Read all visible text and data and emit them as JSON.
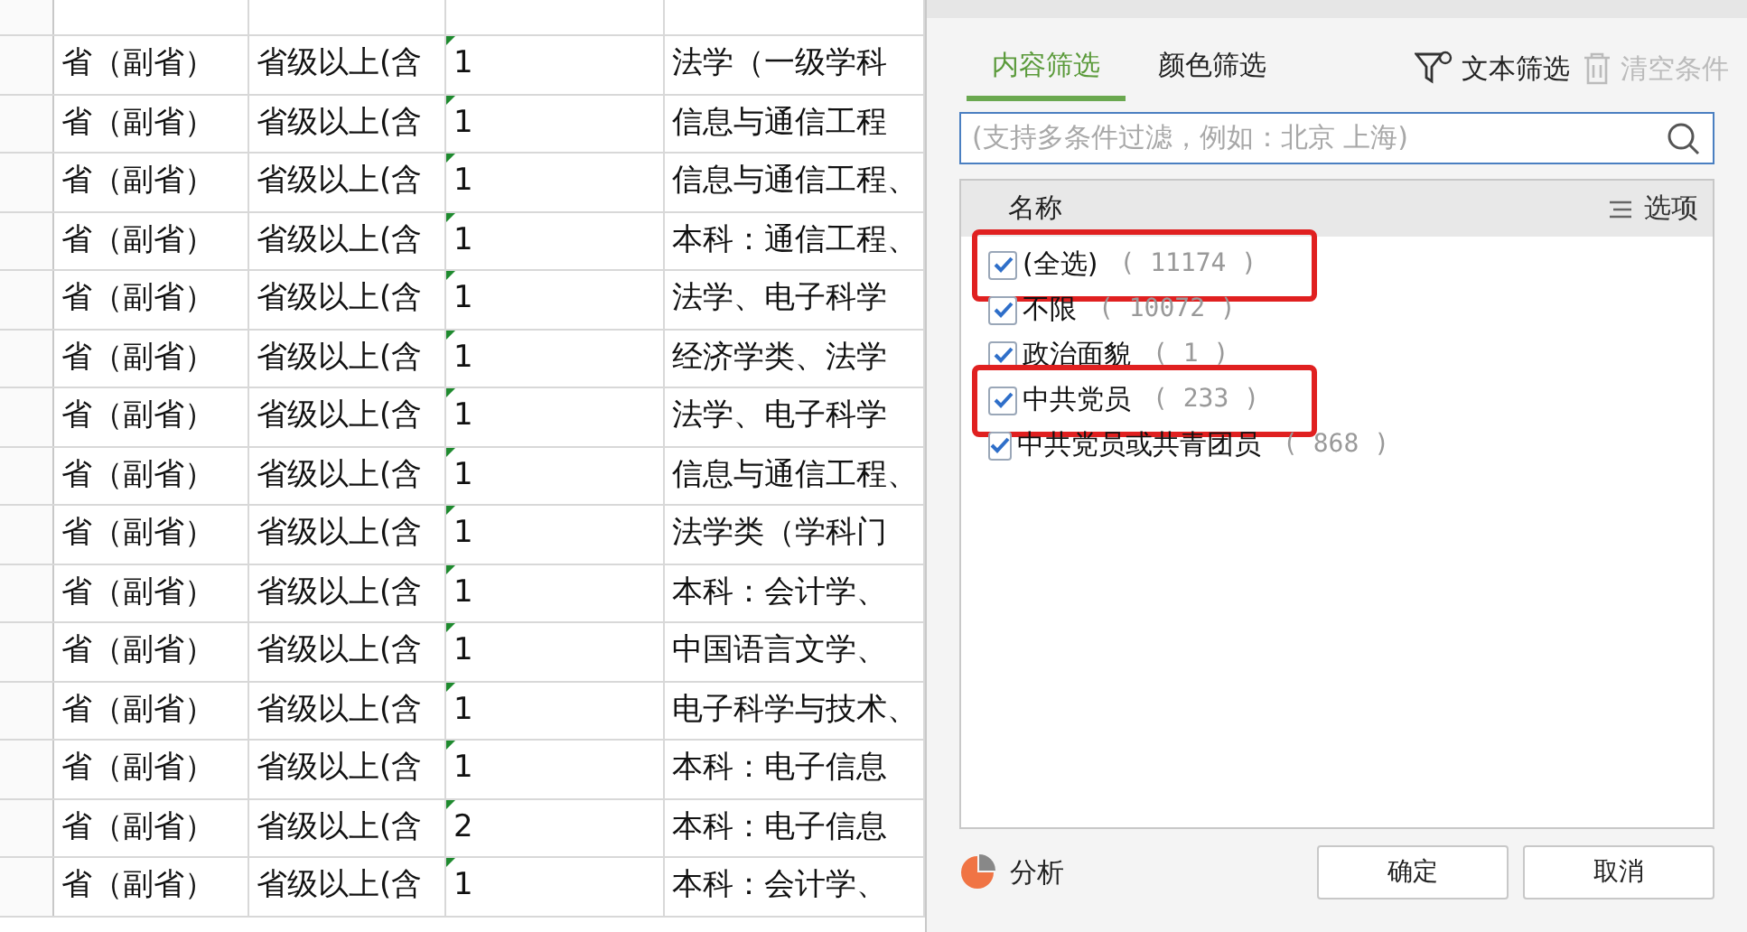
{
  "sheet": {
    "rows": [
      {
        "cells": [
          "省（副省）",
          "省级以上(含",
          "1",
          "法学（一级学科"
        ],
        "number_as_text": true
      },
      {
        "cells": [
          "省（副省）",
          "省级以上(含",
          "1",
          "信息与通信工程"
        ],
        "number_as_text": true
      },
      {
        "cells": [
          "省（副省）",
          "省级以上(含",
          "1",
          "信息与通信工程、"
        ],
        "number_as_text": true
      },
      {
        "cells": [
          "省（副省）",
          "省级以上(含",
          "1",
          "本科：通信工程、"
        ],
        "number_as_text": true
      },
      {
        "cells": [
          "省（副省）",
          "省级以上(含",
          "1",
          "法学、电子科学"
        ],
        "number_as_text": true
      },
      {
        "cells": [
          "省（副省）",
          "省级以上(含",
          "1",
          "经济学类、法学"
        ],
        "number_as_text": true
      },
      {
        "cells": [
          "省（副省）",
          "省级以上(含",
          "1",
          "法学、电子科学"
        ],
        "number_as_text": true
      },
      {
        "cells": [
          "省（副省）",
          "省级以上(含",
          "1",
          "信息与通信工程、"
        ],
        "number_as_text": true
      },
      {
        "cells": [
          "省（副省）",
          "省级以上(含",
          "1",
          "法学类（学科门"
        ],
        "number_as_text": true
      },
      {
        "cells": [
          "省（副省）",
          "省级以上(含",
          "1",
          "本科：会计学、"
        ],
        "number_as_text": true
      },
      {
        "cells": [
          "省（副省）",
          "省级以上(含",
          "1",
          "中国语言文学、"
        ],
        "number_as_text": true
      },
      {
        "cells": [
          "省（副省）",
          "省级以上(含",
          "1",
          "电子科学与技术、"
        ],
        "number_as_text": true
      },
      {
        "cells": [
          "省（副省）",
          "省级以上(含",
          "1",
          "本科：电子信息"
        ],
        "number_as_text": true
      },
      {
        "cells": [
          "省（副省）",
          "省级以上(含",
          "2",
          "本科：电子信息"
        ],
        "number_as_text": true
      },
      {
        "cells": [
          "省（副省）",
          "省级以上(含",
          "1",
          "本科：会计学、"
        ],
        "number_as_text": true
      }
    ]
  },
  "filter": {
    "tabs": [
      {
        "label": "内容筛选",
        "selected": true
      },
      {
        "label": "颜色筛选",
        "selected": false
      }
    ],
    "tools": [
      {
        "label": "文本筛选",
        "disabled": false
      },
      {
        "label": "清空条件",
        "disabled": true
      }
    ],
    "search": {
      "placeholder": "(支持多条件过滤，例如：北京 上海)"
    },
    "list_header": {
      "name": "名称",
      "options": "选项"
    },
    "items": [
      {
        "label": "(全选)",
        "count": "( 11174 )",
        "checked": true,
        "highlighted": true
      },
      {
        "label": "不限",
        "count": "( 10072 )",
        "checked": true,
        "highlighted": false
      },
      {
        "label": "政治面貌",
        "count": "( 1 )",
        "checked": true,
        "highlighted": false
      },
      {
        "label": "中共党员",
        "count": "( 233 )",
        "checked": true,
        "highlighted": true
      },
      {
        "label": "中共党员或共青团员",
        "count": "( 868 )",
        "checked": true,
        "highlighted": false
      }
    ],
    "analyze": "分析",
    "buttons": [
      "确定",
      "取消"
    ]
  }
}
